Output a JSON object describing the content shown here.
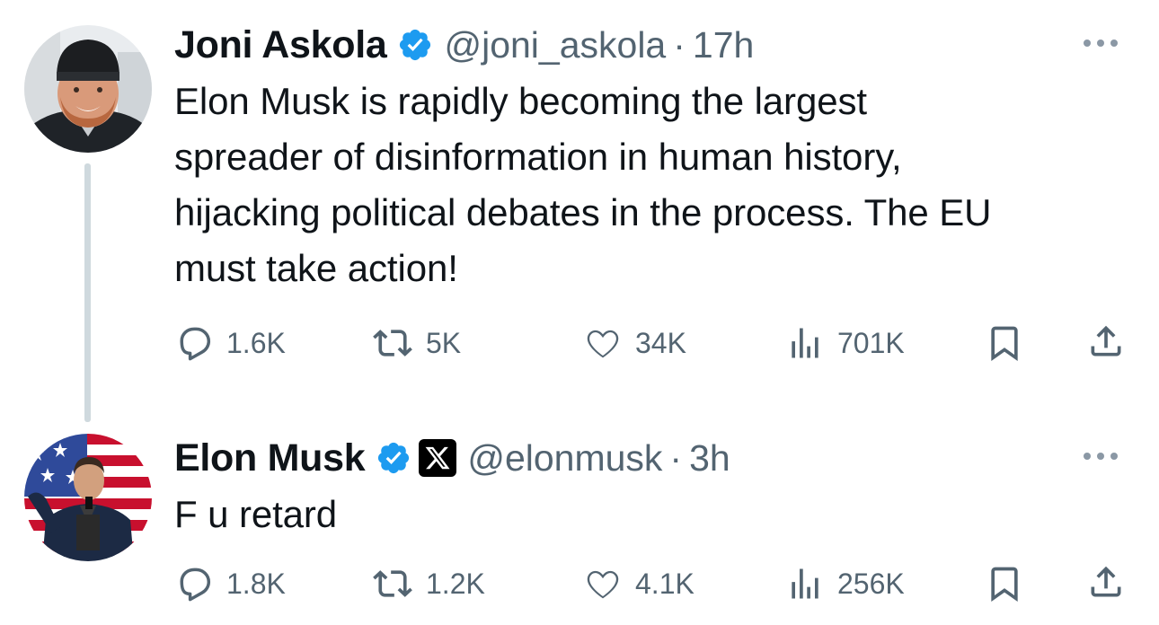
{
  "tweets": [
    {
      "author": {
        "name": "Joni Askola",
        "handle": "@joni_askola",
        "verified": true,
        "affiliate_badge": false
      },
      "separator": "·",
      "time": "17h",
      "text_lines": [
        "Elon Musk is rapidly becoming the largest",
        "spreader of disinformation in human history,",
        "hijacking political debates in the process. The EU",
        "must take action!"
      ],
      "stats": {
        "replies": "1.6K",
        "reposts": "5K",
        "likes": "34K",
        "views": "701K"
      },
      "has_thread_line": true
    },
    {
      "author": {
        "name": "Elon Musk",
        "handle": "@elonmusk",
        "verified": true,
        "affiliate_badge": true
      },
      "separator": "·",
      "time": "3h",
      "text_lines": [
        "F u retard"
      ],
      "stats": {
        "replies": "1.8K",
        "reposts": "1.2K",
        "likes": "4.1K",
        "views": "256K"
      },
      "has_thread_line": false
    }
  ],
  "icons": {
    "verified": "verified-badge-icon",
    "affiliate": "x-logo-icon",
    "reply": "reply-icon",
    "repost": "repost-icon",
    "like": "heart-icon",
    "views": "views-icon",
    "bookmark": "bookmark-icon",
    "share": "share-icon",
    "more": "more-icon"
  },
  "colors": {
    "verified_blue": "#1d9bf0",
    "text_primary": "#0f1419",
    "text_secondary": "#536471",
    "thread_line": "#cfd9de"
  }
}
